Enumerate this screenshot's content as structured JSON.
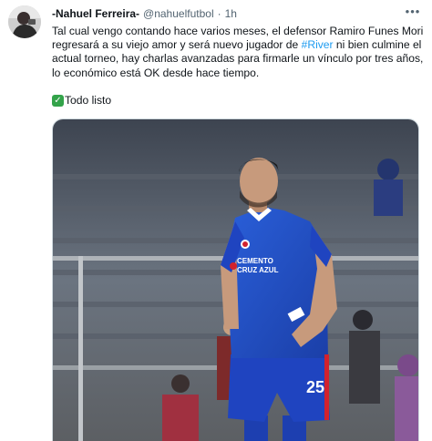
{
  "tweet": {
    "author": {
      "display_name": "-Nahuel Ferreira-",
      "handle": "@nahuelfutbol",
      "avatar_icon": "user-avatar-photo"
    },
    "separator": "·",
    "time": "1h",
    "more_icon": "more-horizontal-icon",
    "text_part1": "Tal cual vengo contando hace varios meses, el defensor Ramiro Funes Mori regresará a su viejo amor y será nuevo jugador de ",
    "hashtag": "#River",
    "text_part2": " ni bien culmine el actual torneo, hay charlas avanzadas para firmarle un vínculo por tres años, lo económico está OK desde hace tiempo.",
    "check_emoji": "✓",
    "check_text": "Todo listo",
    "media": {
      "kind": "photo",
      "shirt_sponsor_line1": "CEMENTO",
      "shirt_sponsor_line2": "CRUZ AZUL",
      "shirt_number": "25"
    }
  },
  "colors": {
    "link": "#1d9bf0",
    "secondary_text": "#536471",
    "jersey_blue": "#1f4fc8",
    "check_green": "#33a34a"
  }
}
